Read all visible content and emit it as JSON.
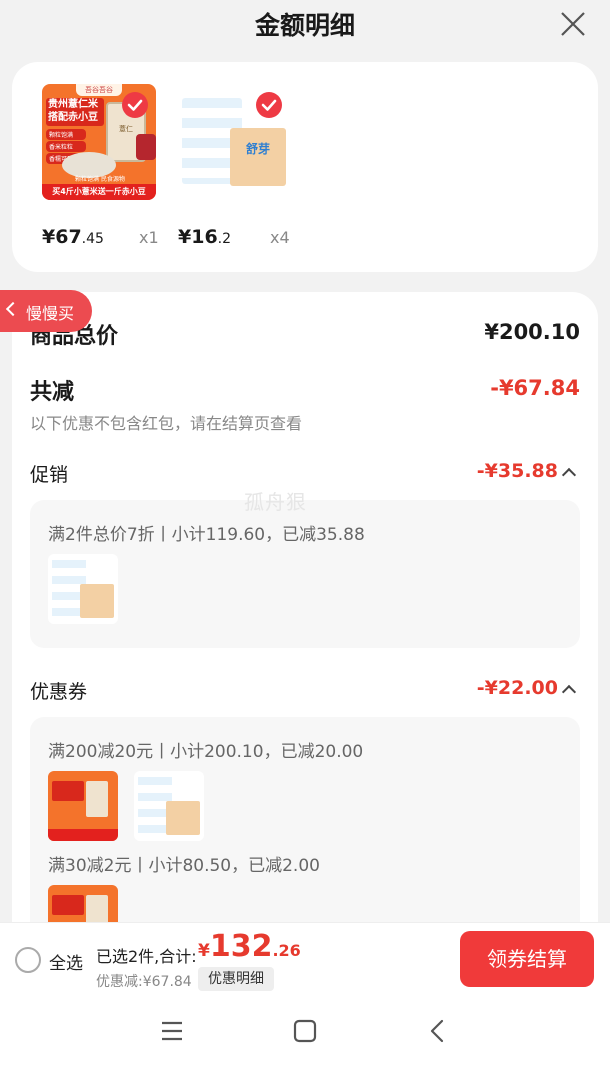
{
  "header": {
    "title": "金额明细"
  },
  "products": [
    {
      "price_int": "¥67",
      "price_dec": ".45",
      "qty": "x1",
      "image": {
        "brand": "吾谷吾谷",
        "line1": "贵州薏仁米",
        "line2": "搭配赤小豆",
        "tags": [
          "颗粒饱满",
          "香米粒粒",
          "香糯可口"
        ],
        "strip": "颗粒饱满 民食源物",
        "banner": "买4斤小薏米送一斤赤小豆",
        "box": "薏仁"
      }
    },
    {
      "price_int": "¥16",
      "price_dec": ".2",
      "qty": "x4",
      "image": {
        "brand": "舒芽"
      }
    }
  ],
  "back_pill": {
    "label": "慢慢买"
  },
  "summary": {
    "goods_total_label": "商品总价",
    "goods_total_value": "¥200.10",
    "total_reduce_label": "共减",
    "total_reduce_value": "-¥67.84",
    "note": "以下优惠不包含红包，请在结算页查看"
  },
  "promotion": {
    "label": "促销",
    "value": "-¥35.88",
    "lines": [
      "满2件总价7折丨小计119.60，已减35.88"
    ]
  },
  "coupon": {
    "label": "优惠券",
    "value": "-¥22.00",
    "lines": [
      "满200减20元丨小计200.10，已减20.00",
      "满30减2元丨小计80.50，已减2.00"
    ]
  },
  "watermark": "孤舟狠",
  "footer": {
    "select_all": "全选",
    "selected_summary": "已选2件,合计:",
    "total_symbol": "¥",
    "total_int": "132",
    "total_dec": ".26",
    "discount_text": "优惠减:¥67.84",
    "detail_tag": "优惠明细",
    "checkout_label": "领券结算"
  },
  "navbar": {
    "icons": [
      "menu-icon",
      "home-square-icon",
      "back-icon"
    ]
  },
  "colors": {
    "accent_red": "#e63a2e",
    "button_red": "#f03a3a",
    "pill_red": "#ec4b50"
  }
}
